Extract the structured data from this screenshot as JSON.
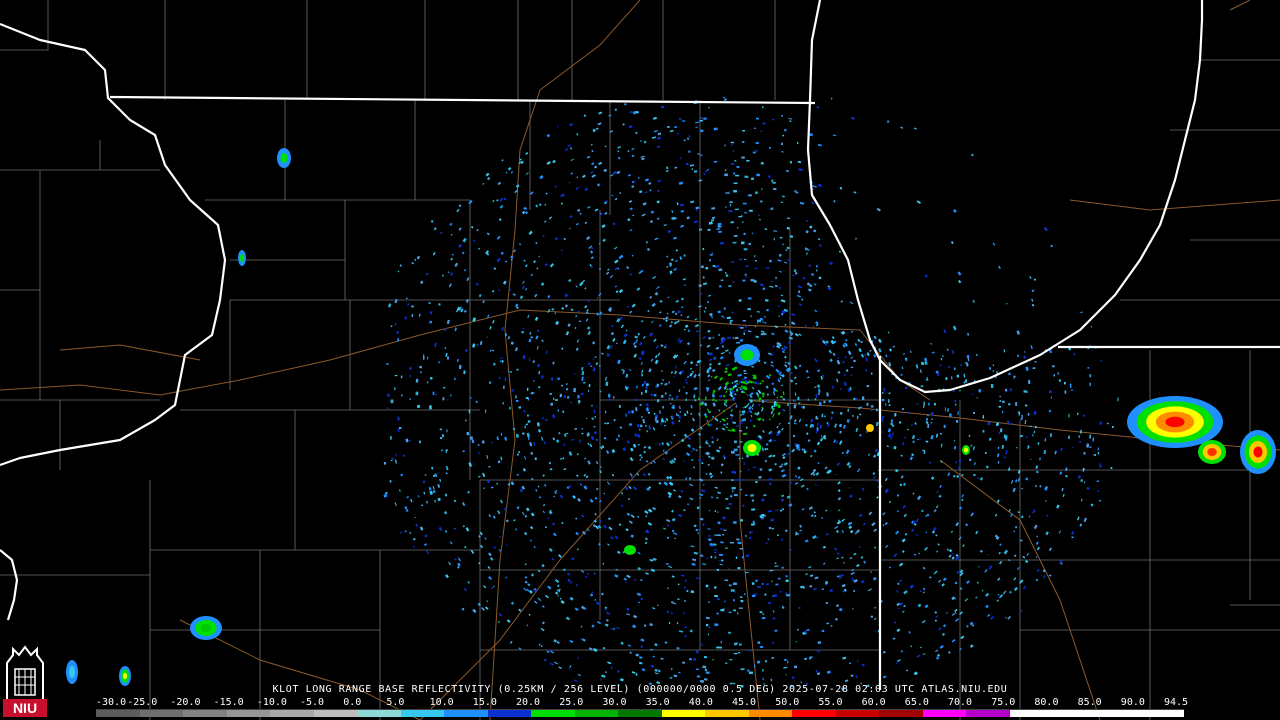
{
  "product": {
    "caption": "KLOT LONG RANGE BASE REFLECTIVITY (0.25KM / 256 LEVEL) (000000/0000 0.5 DEG) 2025-07-28 02:03 UTC  ATLAS.NIU.EDU"
  },
  "scale": {
    "ticks": [
      "-30.0",
      "-25.0",
      "-20.0",
      "-15.0",
      "-10.0",
      "-5.0",
      "0.0",
      "5.0",
      "10.0",
      "15.0",
      "20.0",
      "25.0",
      "30.0",
      "35.0",
      "40.0",
      "45.0",
      "50.0",
      "55.0",
      "60.0",
      "65.0",
      "70.0",
      "75.0",
      "80.0",
      "85.0",
      "90.0",
      "94.5"
    ],
    "colors": [
      "#5c5c5c",
      "#6f6f6f",
      "#828282",
      "#969696",
      "#a9a9a9",
      "#bdbdbd",
      "#8fd8d8",
      "#37c8f0",
      "#1e90ff",
      "#0a30d0",
      "#00e000",
      "#00b400",
      "#007800",
      "#ffff00",
      "#ffc800",
      "#ff8c00",
      "#ff0000",
      "#c80000",
      "#a00000",
      "#ff00ff",
      "#b400c8",
      "#ffffff",
      "#ffffff",
      "#ffffff",
      "#ffffff"
    ]
  },
  "logo": {
    "text": "NIU",
    "color": "#c8102e"
  },
  "map_colors": {
    "borders": "#ffffff",
    "counties": "#7a7a7a",
    "highways": "#8b5a2b"
  }
}
